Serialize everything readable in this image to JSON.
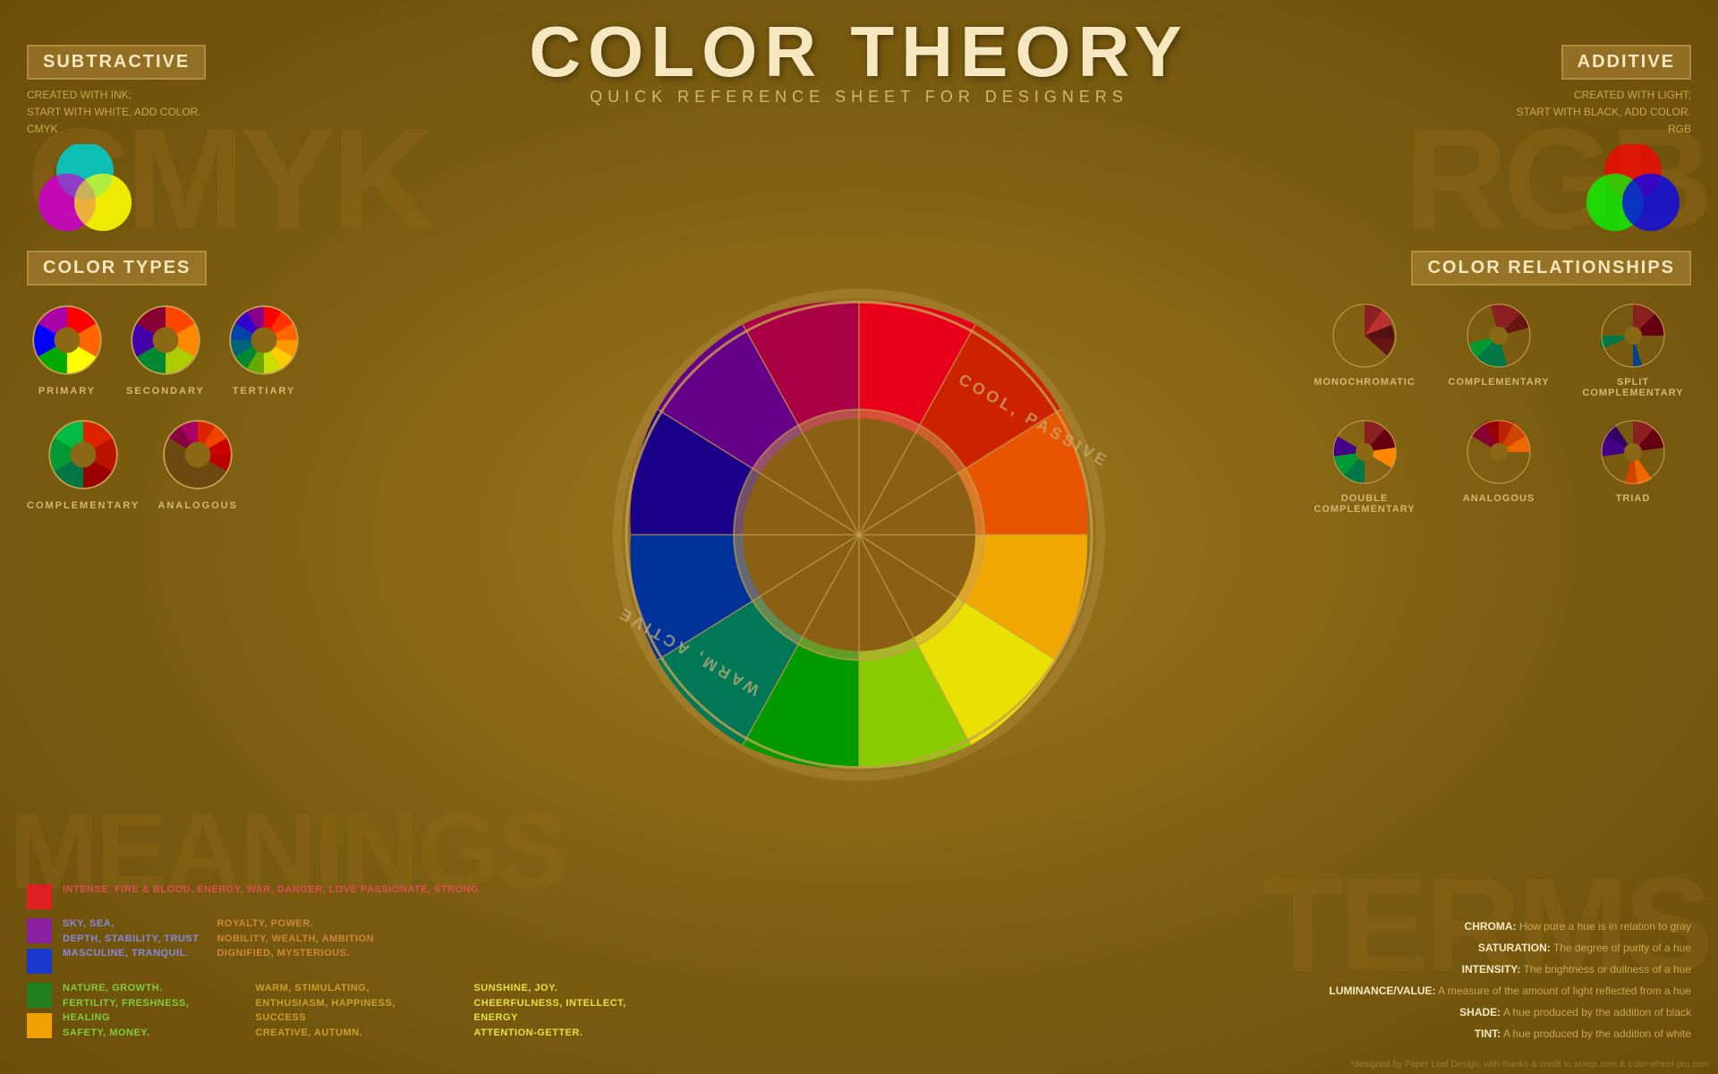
{
  "title": {
    "main": "COLOR THEORY",
    "sub": "QUICK REFERENCE SHEET FOR DESIGNERS"
  },
  "subtractive": {
    "header": "SUBTRACTIVE",
    "line1": "CREATED WITH INK;",
    "line2": "START WITH WHITE, ADD COLOR.",
    "line3": "CMYK"
  },
  "additive": {
    "header": "ADDITIVE",
    "line1": "CREATED WITH LIGHT;",
    "line2": "START WITH BLACK, ADD COLOR.",
    "line3": "RGB"
  },
  "colorTypes": {
    "header": "COLOR TYPES",
    "items": [
      {
        "label": "PRIMARY"
      },
      {
        "label": "SECONDARY"
      },
      {
        "label": "TERTIARY"
      },
      {
        "label": "COMPLEMENTARY"
      },
      {
        "label": "ANALOGOUS"
      }
    ]
  },
  "colorRelationships": {
    "header": "COLOR RELATIONSHIPS",
    "items": [
      {
        "label": "MONOCHROMATIC"
      },
      {
        "label": "COMPLEMENTARY"
      },
      {
        "label": "SPLIT\nCOMPLEMENTARY"
      },
      {
        "label": "DOUBLE\nCOMPLEMENTARY"
      },
      {
        "label": "ANALOGOUS"
      },
      {
        "label": "TRIAD"
      }
    ]
  },
  "meanings": {
    "header": "MEANINGS",
    "items": [
      {
        "color": "#e02020",
        "text": "INTENSE, FIRE & BLOOD, ENERGY, WAR, DANGER, LOVE PASSIONATE, STRONG.",
        "textColor": "#e05050"
      },
      {
        "color": "#8b20a0",
        "text": "SKY, SEA, DEPTH, STABILITY, TRUST MASCULINE, TRANQUIL.",
        "textColor": "#8888dd",
        "text2": "ROYALTY, POWER. NOBILITY, WEALTH, AMBITION DIGNIFIED, MYSTERIOUS.",
        "textColor2": "#cc8840"
      },
      {
        "color": "#1a3acc",
        "text": "NATURE, GROWTH. FERTILITY, FRESHNESS, HEALING SAFETY, MONEY.",
        "textColor": "#80cc40",
        "color2": "#e0e020",
        "text3": "WARM, STIMULATING, ENTHUSIASM, HAPPINESS, SUCCESS CREATIVE, AUTUMN.",
        "textColor3": "#c8a030"
      },
      {
        "color": "#208020",
        "text2": "SUNSHINE, JOY. CHEERFULNESS, INTELLECT, ENERGY ATTENTION-GETTER.",
        "textColor2": "#e8e040",
        "color2": "#f0a000"
      }
    ]
  },
  "terms": {
    "items": [
      {
        "name": "CHROMA:",
        "def": "How pure a hue is in relation to gray"
      },
      {
        "name": "SATURATION:",
        "def": "The degree of purity of a hue"
      },
      {
        "name": "INTENSITY:",
        "def": "The brightness or dullness of a hue"
      },
      {
        "name": "LUMINANCE/VALUE:",
        "def": "A measure of the amount of light reflected from a hue"
      },
      {
        "name": "SHADE:",
        "def": "A hue produced by the addition of black"
      },
      {
        "name": "TINT:",
        "def": "A hue produced by the addition of white"
      }
    ]
  },
  "credit": "*designed by Paper Leaf Design, with thanks & credit to worqx.com & color-wheel-pro.com"
}
